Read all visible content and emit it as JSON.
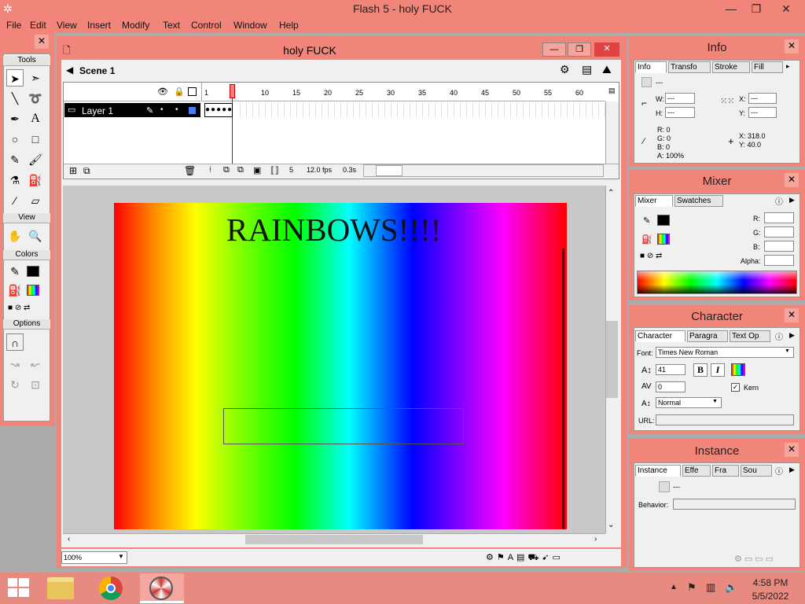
{
  "app": {
    "title": "Flash 5 - holy FUCK"
  },
  "menu": [
    "File",
    "Edit",
    "View",
    "Insert",
    "Modify",
    "Text",
    "Control",
    "Window",
    "Help"
  ],
  "tools": {
    "sections": {
      "tools": "Tools",
      "view": "View",
      "colors": "Colors",
      "options": "Options"
    },
    "colors": {
      "stroke": "#000000",
      "fill": "gradient"
    }
  },
  "document": {
    "title": "holy FUCK",
    "scene": "Scene 1",
    "layer": "Layer 1",
    "frame_numbers": [
      "1",
      "5",
      "10",
      "15",
      "20",
      "25",
      "30",
      "35",
      "40",
      "45",
      "50",
      "55",
      "60"
    ],
    "current_frame": "5",
    "fps": "12.0 fps",
    "elapsed": "0.3s",
    "stage_text": "RAINBOWS!!!!",
    "zoom": "100%"
  },
  "info": {
    "title": "Info",
    "tabs": [
      "Info",
      "Transfo",
      "Stroke",
      "Fill"
    ],
    "w_label": "W:",
    "h_label": "H:",
    "x_label": "X:",
    "y_label": "Y:",
    "w": "---",
    "h": "---",
    "x": "---",
    "y": "---",
    "dash": "---",
    "r": "R: 0",
    "g": "G: 0",
    "b": "B: 0",
    "a": "A: 100%",
    "cx": "X:  318.0",
    "cy": "Y:  40.0"
  },
  "mixer": {
    "title": "Mixer",
    "tabs": [
      "Mixer",
      "Swatches"
    ],
    "r_label": "R:",
    "g_label": "G:",
    "b_label": "B:",
    "alpha_label": "Alpha:"
  },
  "character": {
    "title": "Character",
    "tabs": [
      "Character",
      "Paragra",
      "Text Op"
    ],
    "font_label": "Font:",
    "font": "Times New Roman",
    "size": "41",
    "tracking": "0",
    "baseline": "Normal",
    "kern_label": "Kern",
    "url_label": "URL:",
    "bold": "B",
    "italic": "I"
  },
  "instance": {
    "title": "Instance",
    "tabs": [
      "Instance",
      "Effe",
      "Fra",
      "Sou"
    ],
    "dash": "---",
    "behavior_label": "Behavior:"
  },
  "taskbar": {
    "time": "4:58 PM",
    "date": "5/5/2022"
  }
}
